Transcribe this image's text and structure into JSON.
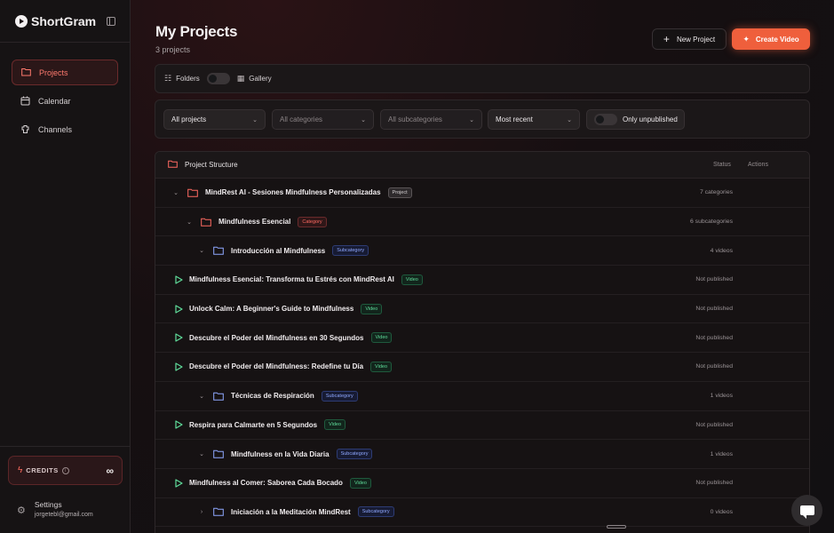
{
  "app": {
    "name": "ShortGram"
  },
  "sidebar": {
    "items": [
      {
        "label": "Projects",
        "icon": "folder-icon",
        "active": true
      },
      {
        "label": "Calendar",
        "icon": "calendar-icon",
        "active": false
      },
      {
        "label": "Channels",
        "icon": "channels-icon",
        "active": false
      }
    ],
    "credits": {
      "label": "CREDITS",
      "value": "∞"
    },
    "settings": {
      "label": "Settings",
      "email": "jorgetebl@gmail.com"
    }
  },
  "header": {
    "title": "My Projects",
    "subtitle": "3 projects",
    "new_project_label": "New Project",
    "create_video_label": "Create Video"
  },
  "view": {
    "folders_label": "Folders",
    "gallery_label": "Gallery",
    "gallery_enabled": false
  },
  "filters": {
    "projects": "All projects",
    "categories": "All categories",
    "subcategories": "All subcategories",
    "sort": "Most recent",
    "only_unpublished_label": "Only unpublished",
    "only_unpublished": false
  },
  "tree": {
    "title": "Project Structure",
    "status_header": "Status",
    "actions_header": "Actions",
    "rows": [
      {
        "type": "project",
        "level": 1,
        "expanded": true,
        "name": "MindRest AI - Sesiones Mindfulness Personalizadas",
        "badge": "Project",
        "meta": "7 categories"
      },
      {
        "type": "category",
        "level": 2,
        "expanded": true,
        "name": "Mindfulness Esencial",
        "badge": "Category",
        "meta": "6 subcategories"
      },
      {
        "type": "subcategory",
        "level": 3,
        "expanded": true,
        "name": "Introducción al Mindfulness",
        "badge": "Subcategory",
        "meta": "4 videos"
      },
      {
        "type": "video",
        "level": 4,
        "name": "Mindfulness Esencial: Transforma tu Estrés con MindRest AI",
        "badge": "Video",
        "meta": "Not published"
      },
      {
        "type": "video",
        "level": 4,
        "name": "Unlock Calm: A Beginner's Guide to Mindfulness",
        "badge": "Video",
        "meta": "Not published"
      },
      {
        "type": "video",
        "level": 4,
        "name": "Descubre el Poder del Mindfulness en 30 Segundos",
        "badge": "Video",
        "meta": "Not published"
      },
      {
        "type": "video",
        "level": 4,
        "name": "Descubre el Poder del Mindfulness: Redefine tu Día",
        "badge": "Video",
        "meta": "Not published"
      },
      {
        "type": "subcategory",
        "level": 3,
        "expanded": true,
        "name": "Técnicas de Respiración",
        "badge": "Subcategory",
        "meta": "1 videos"
      },
      {
        "type": "video",
        "level": 4,
        "name": "Respira para Calmarte en 5 Segundos",
        "badge": "Video",
        "meta": "Not published"
      },
      {
        "type": "subcategory",
        "level": 3,
        "expanded": true,
        "name": "Mindfulness en la Vida Diaria",
        "badge": "Subcategory",
        "meta": "1 videos"
      },
      {
        "type": "video",
        "level": 4,
        "name": "Mindfulness al Comer: Saborea Cada Bocado",
        "badge": "Video",
        "meta": "Not published"
      },
      {
        "type": "subcategory",
        "level": 3,
        "expanded": false,
        "name": "Iniciación a la Meditación MindRest",
        "badge": "Subcategory",
        "meta": "0 videos"
      }
    ]
  },
  "colors": {
    "accent": "#ef5f3c",
    "category_red": "#ff6a62",
    "subcategory_blue": "#8fa8ff",
    "video_green": "#5fdc9a"
  }
}
